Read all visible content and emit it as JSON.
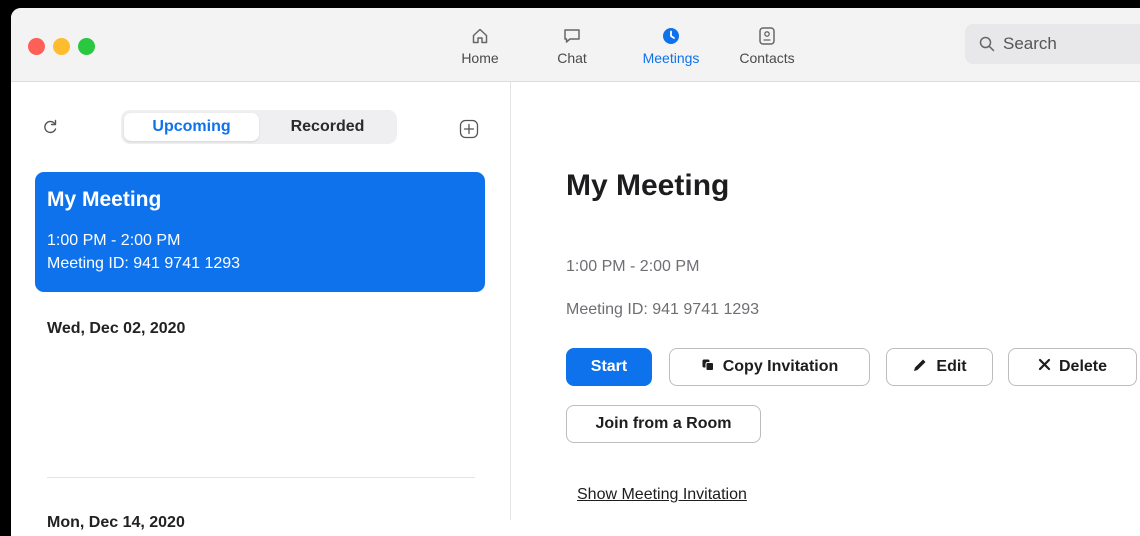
{
  "titlebar": {
    "nav": [
      {
        "label": "Home",
        "icon": "home-icon"
      },
      {
        "label": "Chat",
        "icon": "chat-icon"
      },
      {
        "label": "Meetings",
        "icon": "clock-icon"
      },
      {
        "label": "Contacts",
        "icon": "contact-card-icon"
      }
    ],
    "active_tab": "Meetings",
    "search_placeholder": "Search"
  },
  "left": {
    "tabs": {
      "upcoming": "Upcoming",
      "recorded": "Recorded"
    },
    "selected_meeting": {
      "title": "My Meeting",
      "time": "1:00 PM - 2:00 PM",
      "meeting_id": "Meeting ID: 941 9741 1293"
    },
    "dates": [
      "Wed, Dec 02, 2020",
      "Mon, Dec 14, 2020"
    ]
  },
  "detail": {
    "title": "My Meeting",
    "time": "1:00 PM - 2:00 PM",
    "meeting_id": "Meeting ID: 941 9741 1293",
    "buttons": {
      "start": "Start",
      "copy": "Copy Invitation",
      "edit": "Edit",
      "delete": "Delete",
      "join": "Join from a Room"
    },
    "link": "Show Meeting Invitation"
  },
  "colors": {
    "accent": "#0e72ed",
    "red": "#fe5f57",
    "yellow": "#febc2e",
    "green": "#28c840"
  }
}
